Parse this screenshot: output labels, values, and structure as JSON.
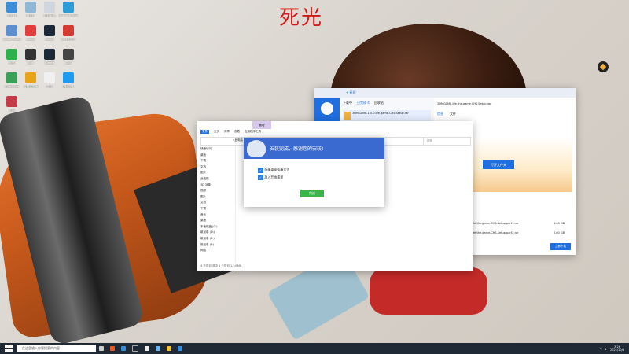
{
  "wallpaper": {
    "title": "死光"
  },
  "desktop_icons": [
    {
      "label": "此电脑",
      "color": "#3a8fd8"
    },
    {
      "label": "回收站",
      "color": "#8fb7d6"
    },
    {
      "label": "控制面板",
      "color": "#cfd6dc"
    },
    {
      "label": "Microsoft Edge",
      "color": "#2c9bd6"
    },
    {
      "label": "Visual Studio",
      "color": "#5c8fd0"
    },
    {
      "label": "Adobe",
      "color": "#e23c3c"
    },
    {
      "label": "Steam",
      "color": "#1b2838"
    },
    {
      "label": "网易云音乐",
      "color": "#d33a31"
    },
    {
      "label": "微信",
      "color": "#2bb24c"
    },
    {
      "label": "Epic",
      "color": "#333"
    },
    {
      "label": "Steam",
      "color": "#1b2838"
    },
    {
      "label": "OBS",
      "color": "#444"
    },
    {
      "label": "Anaconda",
      "color": "#3aa057"
    },
    {
      "label": "谷歌浏览器",
      "color": "#e6a416"
    },
    {
      "label": "文档",
      "color": "#f0f0f0"
    },
    {
      "label": "腾讯QQ",
      "color": "#1d9bf0"
    },
    {
      "label": "原神",
      "color": "#c43a48"
    }
  ],
  "download_manager": {
    "tabs": [
      "下载中",
      "已完成 4",
      "回收站"
    ],
    "new_task": "+ 新建",
    "active_file": "3DMGAME-1.0.0.life.game.CHS.Setup.rar",
    "detail_title": "3DMGAME-life.the.game.CHS.Setup.rar",
    "detail_tabs": [
      "信息",
      "文件"
    ],
    "open_folder": "打开文件夹",
    "files": [
      {
        "name": "life.the.game.CHS.Setup.part1.rar",
        "size": "4.00 GB"
      },
      {
        "name": "life.the.game.CHS.Setup.part2.rar",
        "size": "2.00 GB"
      }
    ],
    "bottom_button": "立即下载"
  },
  "explorer": {
    "ribbon_tabs": [
      "文件",
      "主页",
      "共享",
      "查看",
      "应用程序工具"
    ],
    "manage_tab": "管理",
    "path": "› 此电脑 › 下载",
    "search_placeholder": "搜索",
    "nav_items": [
      "快速访问",
      "桌面",
      "下载",
      "文档",
      "图片",
      "此电脑",
      "3D 对象",
      "视频",
      "图片",
      "文档",
      "下载",
      "音乐",
      "桌面",
      "本地磁盘 (C:)",
      "新加卷 (D:)",
      "新加卷 (E:)",
      "新加卷 (F:)",
      "网络"
    ],
    "status": "4 个项目   选中 1 个项目 1.54 MB"
  },
  "install_dialog": {
    "title": "安装完成，感谢您的安装!",
    "options": [
      "创建桌面快捷方式",
      "加入开始菜单"
    ],
    "finish_button": "完成"
  },
  "taskbar": {
    "search_placeholder": "在这里输入你要搜索的内容",
    "time": "3:26",
    "date": "2021/10/4"
  }
}
